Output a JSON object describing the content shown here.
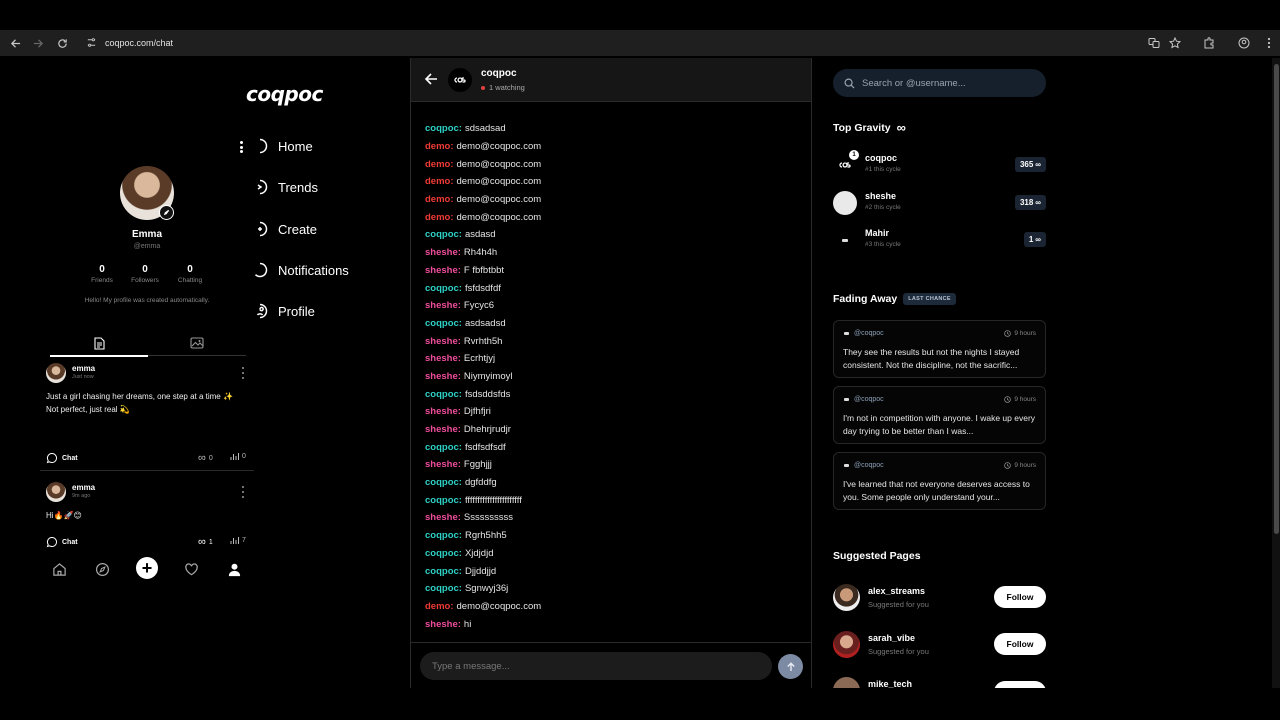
{
  "browser": {
    "url": "coqpoc.com/chat"
  },
  "app": {
    "logo": "coqpoc"
  },
  "nav": [
    {
      "label": "Home"
    },
    {
      "label": "Trends"
    },
    {
      "label": "Create"
    },
    {
      "label": "Notifications"
    },
    {
      "label": "Profile"
    }
  ],
  "profile": {
    "name": "Emma",
    "handle": "@emma",
    "stats": [
      {
        "value": "0",
        "label": "Friends"
      },
      {
        "value": "0",
        "label": "Followers"
      },
      {
        "value": "0",
        "label": "Chatting"
      }
    ],
    "bio": "Hello! My profile was created automatically."
  },
  "posts": [
    {
      "user": "emma",
      "time": "Just now",
      "text": "Just a girl chasing her dreams, one step at a time ✨\nNot perfect, just real 💫",
      "chat": "Chat",
      "gravity": "0",
      "views": "0"
    },
    {
      "user": "emma",
      "time": "9m ago",
      "text": "Hi🔥🚀😊",
      "chat": "Chat",
      "gravity": "1",
      "views": "7"
    }
  ],
  "chat": {
    "title": "coqpoc",
    "watching": "1 watching",
    "messages": [
      {
        "user": "coqpoc",
        "text": "sdsadsad"
      },
      {
        "user": "demo",
        "text": "demo@coqpoc.com"
      },
      {
        "user": "demo",
        "text": "demo@coqpoc.com"
      },
      {
        "user": "demo",
        "text": "demo@coqpoc.com"
      },
      {
        "user": "demo",
        "text": "demo@coqpoc.com"
      },
      {
        "user": "demo",
        "text": "demo@coqpoc.com"
      },
      {
        "user": "coqpoc",
        "text": "asdasd"
      },
      {
        "user": "sheshe",
        "text": "Rh4h4h"
      },
      {
        "user": "sheshe",
        "text": "F fbfbtbbt"
      },
      {
        "user": "coqpoc",
        "text": "fsfdsdfdf"
      },
      {
        "user": "sheshe",
        "text": "Fycyc6"
      },
      {
        "user": "coqpoc",
        "text": "asdsadsd"
      },
      {
        "user": "sheshe",
        "text": "Rvrhth5h"
      },
      {
        "user": "sheshe",
        "text": "Ecrhtjyj"
      },
      {
        "user": "sheshe",
        "text": "Niymyimoyl"
      },
      {
        "user": "coqpoc",
        "text": "fsdsddsfds"
      },
      {
        "user": "sheshe",
        "text": "Djfhfjri"
      },
      {
        "user": "sheshe",
        "text": "Dhehrjrudjr"
      },
      {
        "user": "coqpoc",
        "text": "fsdfsdfsdf"
      },
      {
        "user": "sheshe",
        "text": "Fgghjjj"
      },
      {
        "user": "coqpoc",
        "text": "dgfddfg"
      },
      {
        "user": "coqpoc",
        "text": "fffffffffffffffffffffff"
      },
      {
        "user": "sheshe",
        "text": "Ssssssssss"
      },
      {
        "user": "coqpoc",
        "text": "Rgrh5hh5"
      },
      {
        "user": "coqpoc",
        "text": "Xjdjdjd"
      },
      {
        "user": "coqpoc",
        "text": "Djjddjjd"
      },
      {
        "user": "coqpoc",
        "text": "Sgnwyj36j"
      },
      {
        "user": "demo",
        "text": "demo@coqpoc.com"
      },
      {
        "user": "sheshe",
        "text": "hi"
      }
    ],
    "input_placeholder": "Type a message..."
  },
  "sidebar": {
    "search_placeholder": "Search or @username...",
    "top_gravity": {
      "title": "Top Gravity",
      "items": [
        {
          "name": "coqpoc",
          "sub": "#1 this cycle",
          "score": "365",
          "badge": "1"
        },
        {
          "name": "sheshe",
          "sub": "#2 this cycle",
          "score": "318"
        },
        {
          "name": "Mahir",
          "sub": "#3 this cycle",
          "score": "1"
        }
      ]
    },
    "fading_away": {
      "title": "Fading Away",
      "badge": "LAST CHANCE",
      "cards": [
        {
          "user": "@coqpoc",
          "time": "9 hours",
          "text": "They see the results but not the nights I stayed consistent. Not the discipline, not the sacrific..."
        },
        {
          "user": "@coqpoc",
          "time": "9 hours",
          "text": "I'm not in competition with anyone. I wake up every day trying to be better than I was..."
        },
        {
          "user": "@coqpoc",
          "time": "9 hours",
          "text": "I've learned that not everyone deserves access to you. Some people only understand your..."
        }
      ]
    },
    "suggested": {
      "title": "Suggested Pages",
      "items": [
        {
          "name": "alex_streams",
          "sub": "Suggested for you",
          "action": "Follow"
        },
        {
          "name": "sarah_vibe",
          "sub": "Suggested for you",
          "action": "Follow"
        },
        {
          "name": "mike_tech",
          "sub": "",
          "action": ""
        }
      ]
    }
  },
  "colors": {
    "coqpoc": "#2ed1c5",
    "demo": "#ef3b36",
    "sheshe": "#ee4d9b"
  }
}
